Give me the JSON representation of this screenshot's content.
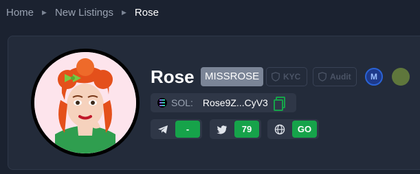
{
  "breadcrumb": {
    "home": "Home",
    "section": "New Listings",
    "current": "Rose"
  },
  "token": {
    "name": "Rose",
    "ticker": "MISSROSE",
    "kyc_label": "KYC",
    "audit_label": "Audit",
    "chain_label": "SOL:",
    "address": "Rose9Z...CyV3"
  },
  "socials": {
    "telegram_value": "-",
    "twitter_value": "79",
    "website_value": "GO"
  },
  "icons": [
    "chevron-right-icon",
    "shield-icon",
    "coinmarketcap-icon",
    "coingecko-icon",
    "solana-icon",
    "copy-icon",
    "telegram-icon",
    "twitter-icon",
    "globe-icon"
  ],
  "colors": {
    "accent_green": "#16a34a",
    "ticker_bg": "#7b8597",
    "background": "#1b2230",
    "card": "#232b3a"
  }
}
